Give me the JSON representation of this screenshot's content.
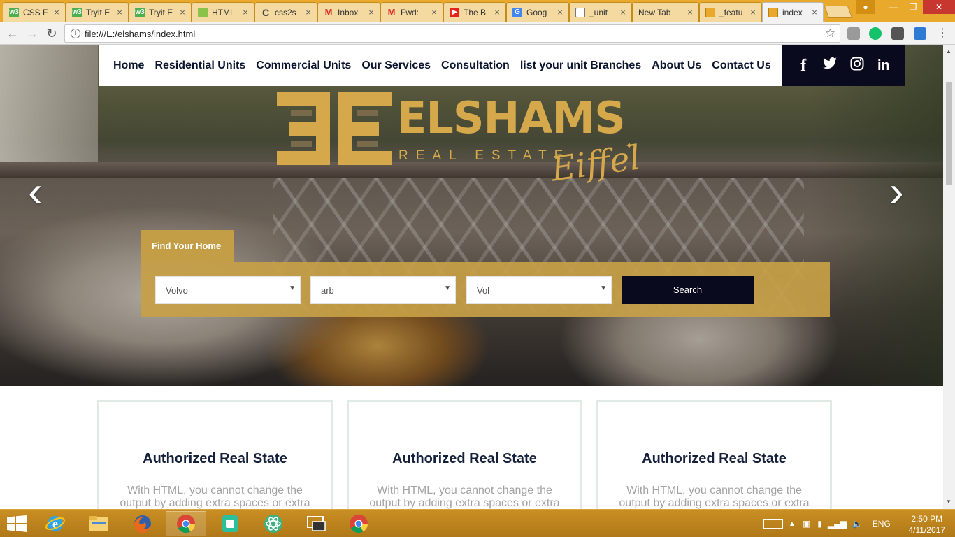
{
  "browser": {
    "tabs": [
      {
        "title": "CSS F",
        "icon": "w3schools-icon",
        "color": "#4caf50"
      },
      {
        "title": "Tryit E",
        "icon": "w3schools-icon",
        "color": "#4caf50"
      },
      {
        "title": "Tryit E",
        "icon": "w3schools-icon",
        "color": "#4caf50"
      },
      {
        "title": "HTML",
        "icon": "html-doc-icon",
        "color": "#8bc34a"
      },
      {
        "title": "css2s",
        "icon": "loading-icon",
        "color": "#444444"
      },
      {
        "title": "Inbox",
        "icon": "gmail-icon",
        "color": "#d93025"
      },
      {
        "title": "Fwd:",
        "icon": "gmail-icon",
        "color": "#d93025"
      },
      {
        "title": "The B",
        "icon": "youtube-icon",
        "color": "#e62117"
      },
      {
        "title": "Goog",
        "icon": "google-docs-icon",
        "color": "#4285f4"
      },
      {
        "title": "_unit",
        "icon": "file-icon",
        "color": "#777777"
      },
      {
        "title": "New Tab",
        "icon": "",
        "color": ""
      },
      {
        "title": "_featu",
        "icon": "image-file-icon",
        "color": "#e8a92c"
      },
      {
        "title": "index",
        "icon": "image-file-icon",
        "color": "#e8a92c"
      }
    ],
    "url": "file:///E:/elshams/index.html"
  },
  "site": {
    "nav": [
      "Home",
      "Residential Units",
      "Commercial Units",
      "Our Services",
      "Consultation",
      "list your unit Branches",
      "About Us",
      "Contact Us"
    ],
    "social": [
      "f",
      "twitter",
      "instagram",
      "in"
    ],
    "logo": {
      "word": "ELSHAMS",
      "sub": "REAL ESTATE",
      "script": "Eiffel"
    },
    "search": {
      "tab_label": "Find Your Home",
      "selects": [
        "Volvo",
        "arb",
        "Vol"
      ],
      "button": "Search"
    },
    "cards": [
      {
        "title": "Authorized Real State",
        "text": "With HTML, you cannot change the output by adding extra spaces or extra"
      },
      {
        "title": "Authorized Real State",
        "text": "With HTML, you cannot change the output by adding extra spaces or extra"
      },
      {
        "title": "Authorized Real State",
        "text": "With HTML, you cannot change the output by adding extra spaces or extra"
      }
    ]
  },
  "taskbar": {
    "apps": [
      "internet-explorer-icon",
      "file-explorer-icon",
      "firefox-icon",
      "chrome-icon",
      "pushbullet-icon",
      "atom-icon",
      "remote-desktop-icon",
      "chrome-icon"
    ],
    "lang": "ENG",
    "time": "2:50 PM",
    "date": "4/11/2017"
  },
  "colors": {
    "gold": "#c49e47",
    "navy": "#0a0a1f",
    "taskbar": "#c98f24"
  }
}
